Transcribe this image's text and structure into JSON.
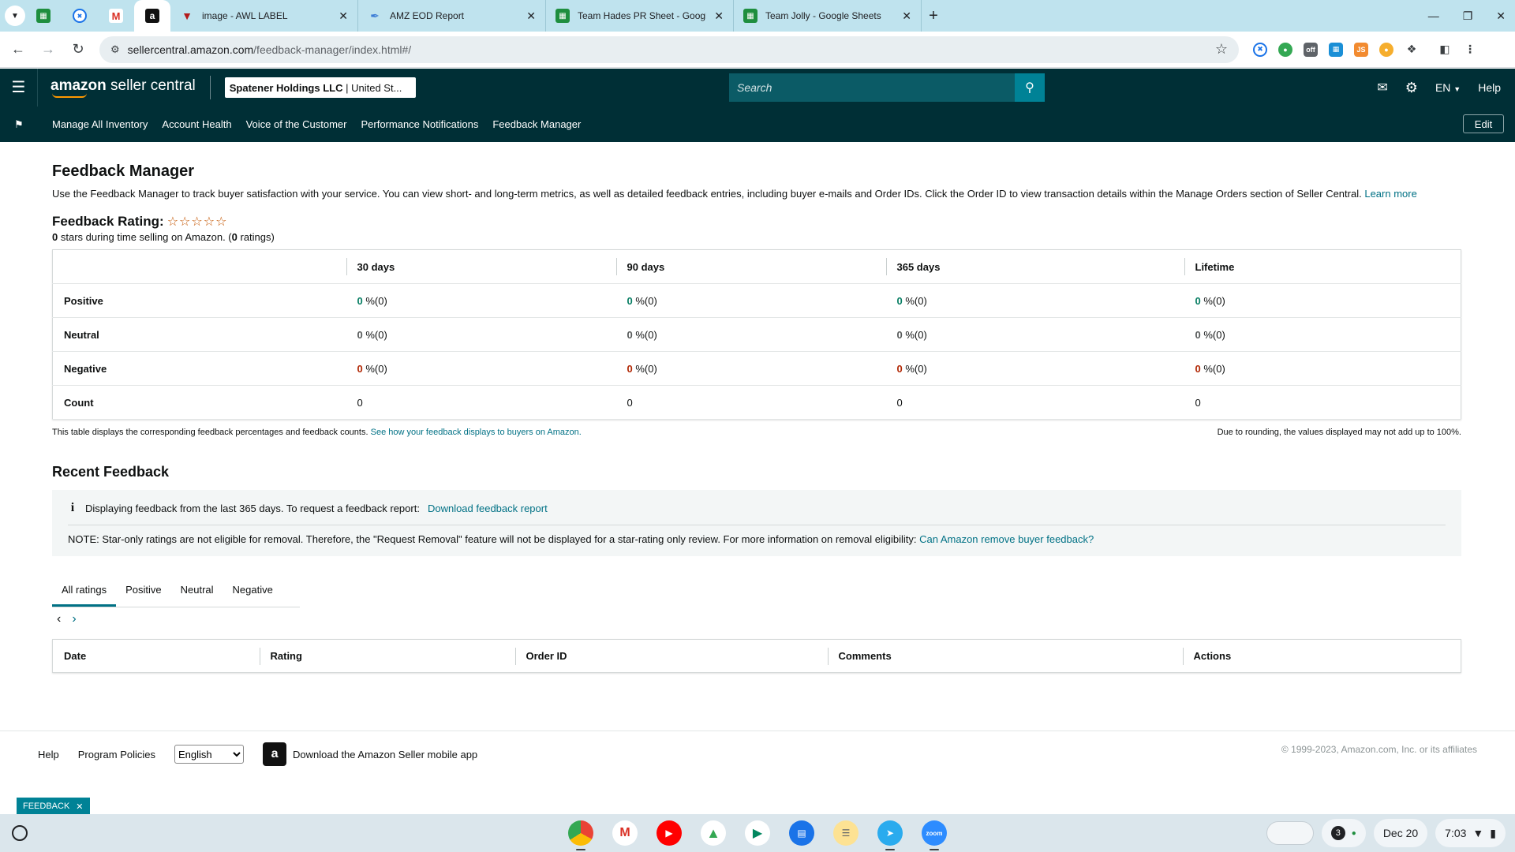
{
  "browser": {
    "tabs": [
      {
        "title": "image - AWL LABEL",
        "icon": "awl-icon"
      },
      {
        "title": "AMZ EOD Report",
        "icon": "eod-icon"
      },
      {
        "title": "Team Hades PR Sheet - Google",
        "icon": "sheets-icon"
      },
      {
        "title": "Team Jolly - Google Sheets",
        "icon": "sheets-icon"
      }
    ],
    "url_host": "sellercentral.amazon.com",
    "url_path": "/feedback-manager/index.html#/"
  },
  "header": {
    "logo_main": "amazon",
    "logo_sub": "seller central",
    "account_name": "Spatener Holdings LLC",
    "account_region": "| United St...",
    "search_placeholder": "Search",
    "language": "EN",
    "help": "Help"
  },
  "subnav": {
    "links": [
      "Manage All Inventory",
      "Account Health",
      "Voice of the Customer",
      "Performance Notifications",
      "Feedback Manager"
    ],
    "edit": "Edit"
  },
  "page": {
    "title": "Feedback Manager",
    "intro": "Use the Feedback Manager to track buyer satisfaction with your service. You can view short- and long-term metrics, as well as detailed feedback entries, including buyer e-mails and Order IDs. Click the Order ID to view transaction details within the Manage Orders section of Seller Central.",
    "learn_more": "Learn more",
    "rating_label": "Feedback Rating:",
    "stars_value": "0",
    "stars_text": "stars during time selling on Amazon. (",
    "ratings_value": "0",
    "ratings_text": "ratings)"
  },
  "feedback_table": {
    "columns": [
      "30 days",
      "90 days",
      "365 days",
      "Lifetime"
    ],
    "rows": [
      {
        "label": "Positive",
        "values": [
          "0",
          "0",
          "0",
          "0"
        ],
        "suffix": "%(0)"
      },
      {
        "label": "Neutral",
        "values": [
          "0",
          "0",
          "0",
          "0"
        ],
        "suffix": "%(0)"
      },
      {
        "label": "Negative",
        "values": [
          "0",
          "0",
          "0",
          "0"
        ],
        "suffix": "%(0)"
      },
      {
        "label": "Count",
        "values": [
          "0",
          "0",
          "0",
          "0"
        ]
      }
    ],
    "note_left": "This table displays the corresponding feedback percentages and feedback counts.",
    "note_link": "See how your feedback displays to buyers on Amazon.",
    "note_right": "Due to rounding, the values displayed may not add up to 100%."
  },
  "recent": {
    "title": "Recent Feedback",
    "info_text": "Displaying feedback from the last 365 days. To request a feedback report:",
    "info_link": "Download feedback report",
    "note_text": "NOTE: Star-only ratings are not eligible for removal. Therefore, the \"Request Removal\" feature will not be displayed for a star-rating only review. For more information on removal eligibility:",
    "note_link": "Can Amazon remove buyer feedback?",
    "tabs": [
      "All ratings",
      "Positive",
      "Neutral",
      "Negative"
    ],
    "columns": [
      "Date",
      "Rating",
      "Order ID",
      "Comments",
      "Actions"
    ]
  },
  "footer": {
    "help": "Help",
    "policies": "Program Policies",
    "language_selected": "English",
    "app_text": "Download the Amazon Seller mobile app",
    "copyright": "© 1999-2023, Amazon.com, Inc. or its affiliates",
    "chip": "FEEDBACK"
  },
  "shelf": {
    "notifications": "3",
    "date": "Dec 20",
    "time": "7:03"
  },
  "colors": {
    "header_bg": "#002f36",
    "accent": "#007185",
    "positive": "#067d62",
    "negative": "#b12704"
  }
}
